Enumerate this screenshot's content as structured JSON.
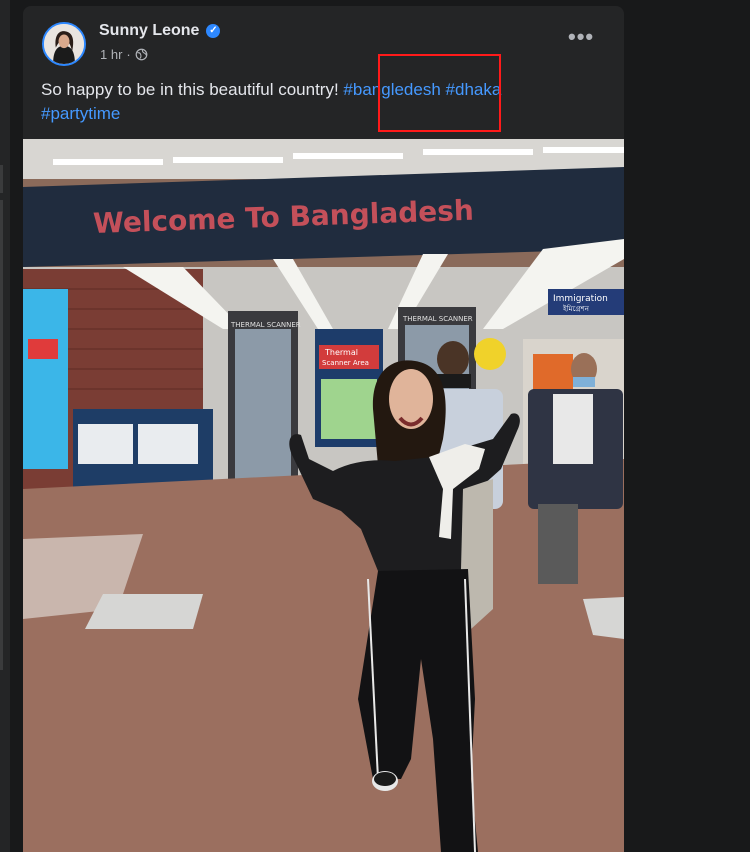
{
  "post": {
    "author": "Sunny Leone",
    "time": "1 hr",
    "privacy_icon": "globe-icon",
    "text_before": "So happy to be in this beautiful country! ",
    "hashtags": [
      "#bangledesh",
      "#dhaka",
      "#partytime"
    ],
    "more_icon": "more-options-icon"
  },
  "photo": {
    "banner_text": "Welcome To Bangladesh",
    "sign_thermal_left": "THERMAL SCANNER",
    "sign_thermal_right": "THERMAL SCANNER",
    "sign_scanner_area_1": "Thermal",
    "sign_scanner_area_2": "Scanner Area",
    "sign_immigration": "Immigration",
    "sign_immigration_bn": "ইমিগ্রেশন"
  },
  "colors": {
    "background": "#18191a",
    "card": "#242526",
    "link": "#4599ff",
    "verified": "#2d88ff",
    "highlight_box": "#ff1a1a"
  }
}
